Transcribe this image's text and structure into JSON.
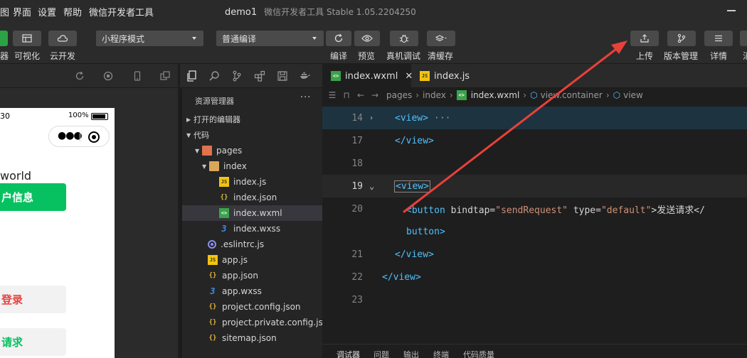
{
  "menubar": {
    "items": [
      "图",
      "界面",
      "设置",
      "帮助",
      "微信开发者工具"
    ],
    "project_name": "demo1",
    "app_title": "微信开发者工具 Stable 1.05.2204250"
  },
  "toolbar": {
    "left_labels": [
      "器",
      "可视化",
      "云开发"
    ],
    "mode_select": "小程序模式",
    "compile_select": "普通编译",
    "action_labels": [
      "编译",
      "预览",
      "真机调试",
      "清缓存"
    ],
    "right_labels": [
      "上传",
      "版本管理",
      "详情",
      "消"
    ]
  },
  "simulator": {
    "time": "30",
    "battery": "100%",
    "hello_text": "world",
    "btn_userinfo": "户信息",
    "btn_login": "登录",
    "btn_request": "请求",
    "colors": {
      "primary": "#07c160",
      "danger": "#e64340"
    }
  },
  "explorer": {
    "title": "资源管理器",
    "more": "···",
    "section_open": "打开的编辑器",
    "section_code": "代码",
    "tree": [
      {
        "label": "pages",
        "icon": "folder-pages-icon"
      },
      {
        "label": "index",
        "icon": "folder-icon"
      },
      {
        "label": "index.js",
        "icon": "js-file-icon"
      },
      {
        "label": "index.json",
        "icon": "json-file-icon"
      },
      {
        "label": "index.wxml",
        "icon": "wxml-file-icon"
      },
      {
        "label": "index.wxss",
        "icon": "wxss-file-icon"
      },
      {
        "label": ".eslintrc.js",
        "icon": "eslint-file-icon"
      },
      {
        "label": "app.js",
        "icon": "js-file-icon"
      },
      {
        "label": "app.json",
        "icon": "json-file-icon"
      },
      {
        "label": "app.wxss",
        "icon": "wxss-file-icon"
      },
      {
        "label": "project.config.json",
        "icon": "json-file-icon"
      },
      {
        "label": "project.private.config.js...",
        "icon": "json-file-icon"
      },
      {
        "label": "sitemap.json",
        "icon": "json-file-icon"
      }
    ]
  },
  "editor": {
    "tabs": [
      "index.wxml",
      "index.js"
    ],
    "close_glyph": "✕",
    "breadcrumb": [
      "pages",
      "index",
      "index.wxml",
      "view.container",
      "view"
    ],
    "lines": {
      "l14": "14",
      "l17": "17",
      "l18": "18",
      "l19": "19",
      "l20": "20",
      "l21": "21",
      "l22": "22",
      "l23": "23"
    },
    "code": {
      "view_open": "<view>",
      "view_fold": "···",
      "view_close": "</view>",
      "btn_open_tag": "<button",
      "attr_bindtap": "bindtap=",
      "val_bindtap": "\"sendRequest\"",
      "attr_type": "type=",
      "val_type": "\"default\"",
      "btn_text": ">发送请求</",
      "btn_close": "button>"
    }
  },
  "panel": {
    "tabs": [
      "调试器",
      "问题",
      "输出",
      "终端",
      "代码质量"
    ]
  },
  "annotation": {
    "color": "#e8413a"
  }
}
